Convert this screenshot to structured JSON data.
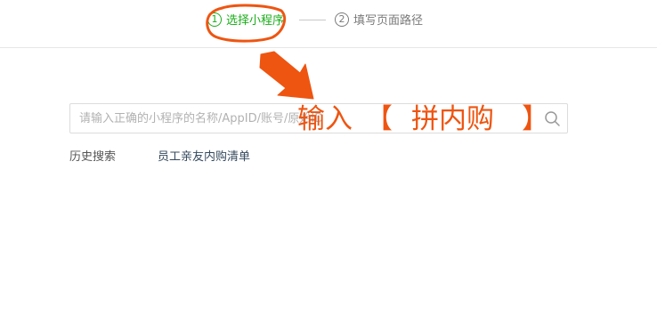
{
  "steps": [
    {
      "number": "1",
      "label": "选择小程序",
      "active": true
    },
    {
      "number": "2",
      "label": "填写页面路径",
      "active": false
    }
  ],
  "search": {
    "placeholder": "请输入正确的小程序的名称/AppID/账号/原始ID",
    "value": ""
  },
  "history": {
    "label": "历史搜索",
    "items": [
      "员工亲友内购清单"
    ]
  },
  "annotation": {
    "main": "输入",
    "bracket_open": "【",
    "word": "拼内购",
    "bracket_close": "】",
    "color": "#ee5511"
  },
  "colors": {
    "active_step": "#1aad19",
    "inactive_step": "#7a7a7a",
    "border": "#dcdcdc"
  }
}
